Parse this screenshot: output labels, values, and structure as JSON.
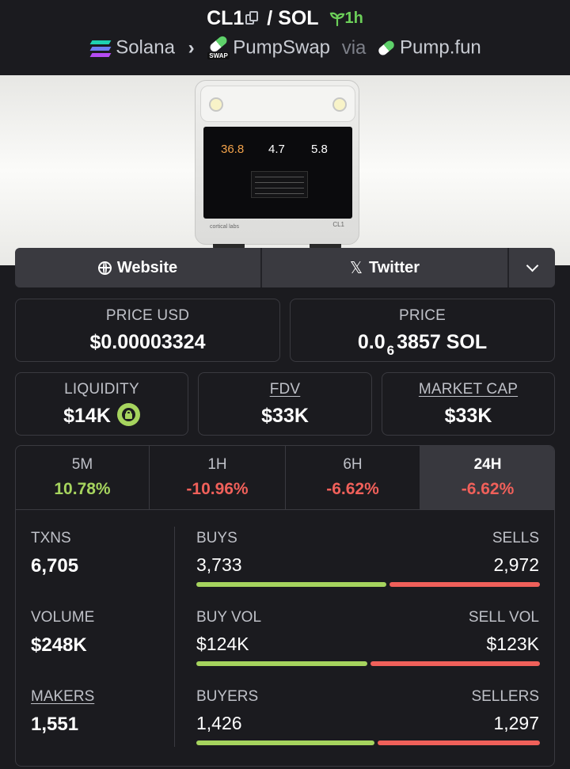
{
  "header": {
    "base_symbol": "CL1",
    "separator": "/",
    "quote_symbol": "SOL",
    "age": "1h",
    "chain": "Solana",
    "dex": "PumpSwap",
    "via_label": "via",
    "launchpad": "Pump.fun",
    "swap_badge": "SWAP"
  },
  "banner": {
    "screen_values": [
      "36.8",
      "4.7",
      "5.8"
    ],
    "screen_value_colors": [
      "#f2a24a",
      "#ffffff",
      "#ffffff"
    ],
    "brand": "cortical labs",
    "model": "CL1"
  },
  "links": {
    "website_label": "Website",
    "twitter_label": "Twitter",
    "icons": [
      "globe-icon",
      "x-logo-icon",
      "chevron-down-icon"
    ]
  },
  "price": {
    "usd_label": "PRICE USD",
    "usd_value": "$0.00003324",
    "native_label": "PRICE",
    "native_prefix": "0.0",
    "native_zero_count": "6",
    "native_digits": "3857 SOL"
  },
  "metrics": {
    "liquidity_label": "LIQUIDITY",
    "liquidity_value": "$14K",
    "fdv_label": "FDV",
    "fdv_value": "$33K",
    "mcap_label": "MARKET CAP",
    "mcap_value": "$33K"
  },
  "timeframes": [
    {
      "label": "5M",
      "change": "10.78%",
      "color": "#a6d45e"
    },
    {
      "label": "1H",
      "change": "-10.96%",
      "color": "#f0605a"
    },
    {
      "label": "6H",
      "change": "-6.62%",
      "color": "#f0605a"
    },
    {
      "label": "24H",
      "change": "-6.62%",
      "color": "#f0605a",
      "selected": true
    }
  ],
  "stats": {
    "txns_label": "TXNS",
    "txns_value": "6,705",
    "volume_label": "VOLUME",
    "volume_value": "$248K",
    "makers_label": "MAKERS",
    "makers_value": "1,551",
    "buys_label": "BUYS",
    "buys_value": "3,733",
    "sells_label": "SELLS",
    "sells_value": "2,972",
    "buy_vol_label": "BUY VOL",
    "buy_vol_value": "$124K",
    "sell_vol_label": "SELL VOL",
    "sell_vol_value": "$123K",
    "buyers_label": "BUYERS",
    "buyers_value": "1,426",
    "sellers_label": "SELLERS",
    "sellers_value": "1,297",
    "buy_share_txns": 0.557,
    "buy_share_volume": 0.502,
    "buy_share_makers": 0.524
  },
  "colors": {
    "buy": "#a6d45e",
    "sell": "#f0605a",
    "age": "#6ccf59",
    "background": "#1b1b1f"
  }
}
